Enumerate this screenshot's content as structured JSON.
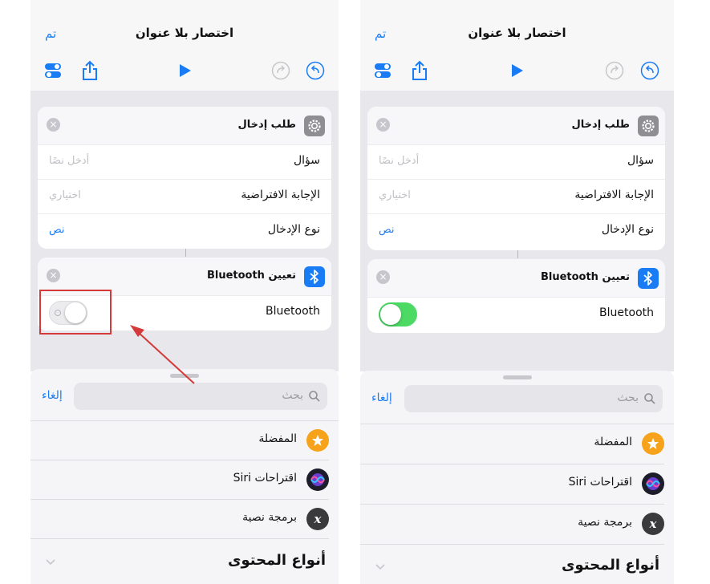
{
  "panels": [
    {
      "id": "before",
      "nav": {
        "done": "تم",
        "title": "اختصار بلا عنوان"
      },
      "ask_card": {
        "title": "طلب إدخال",
        "rows": [
          {
            "label": "سؤال",
            "value": "أدخل نصًا"
          },
          {
            "label": "الإجابة الافتراضية",
            "value": "اختياري"
          },
          {
            "label": "نوع الإدخال",
            "value": "نص"
          }
        ]
      },
      "bt_card": {
        "title": "تعيين Bluetooth",
        "row_label": "Bluetooth",
        "toggle_on": false
      },
      "sheet": {
        "cancel": "إلغاء",
        "search_placeholder": "بحث",
        "items": [
          {
            "label": "المفضلة",
            "icon": "star-icon"
          },
          {
            "label": "اقتراحات Siri",
            "icon": "siri-icon"
          },
          {
            "label": "برمجة نصية",
            "icon": "scripting-x-icon"
          }
        ],
        "section": "أنواع المحتوى"
      }
    },
    {
      "id": "after",
      "nav": {
        "done": "تم",
        "title": "اختصار بلا عنوان"
      },
      "ask_card": {
        "title": "طلب إدخال",
        "rows": [
          {
            "label": "سؤال",
            "value": "أدخل نصًا"
          },
          {
            "label": "الإجابة الافتراضية",
            "value": "اختياري"
          },
          {
            "label": "نوع الإدخال",
            "value": "نص"
          }
        ]
      },
      "bt_card": {
        "title": "تعيين Bluetooth",
        "row_label": "Bluetooth",
        "toggle_on": true
      },
      "sheet": {
        "cancel": "إلغاء",
        "search_placeholder": "بحث",
        "items": [
          {
            "label": "المفضلة",
            "icon": "star-icon"
          },
          {
            "label": "اقتراحات Siri",
            "icon": "siri-icon"
          },
          {
            "label": "برمجة نصية",
            "icon": "scripting-x-icon"
          }
        ],
        "section": "أنواع المحتوى"
      }
    }
  ],
  "colors": {
    "accent_blue": "#1a7cf5",
    "toggle_on_green": "#4cd964",
    "annotation_red": "#d43a3a",
    "favorites_orange": "#f7a21b",
    "bluetooth_blue": "#1a7cf5",
    "settings_gray": "#8e8e93"
  }
}
